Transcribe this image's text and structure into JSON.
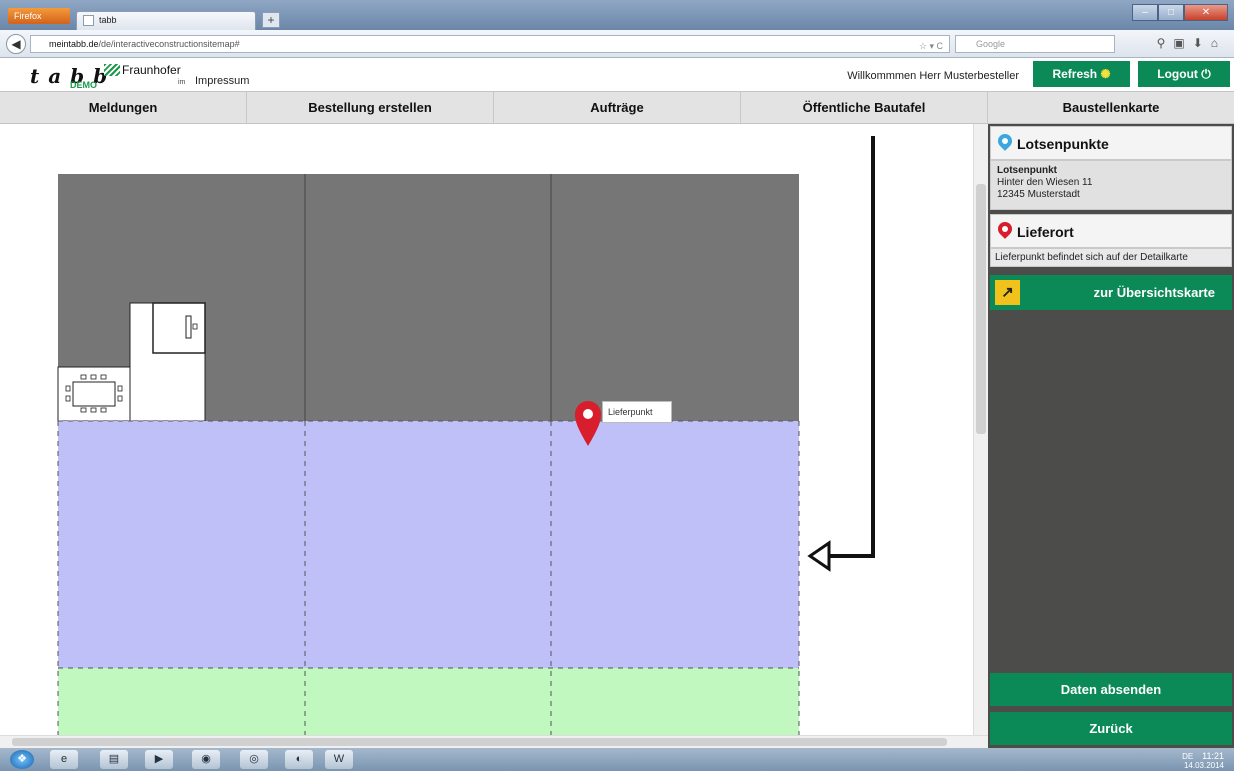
{
  "browser": {
    "app_button": "Firefox",
    "tab_title": "tabb",
    "new_tab": "+",
    "url_host": "meintabb.de",
    "url_path": "/de/interactiveconstructionsitemap#",
    "search_placeholder": "Google"
  },
  "header": {
    "logo": "t a b b",
    "demo": "DEMO",
    "fraunhofer": "Fraunhofer",
    "impressum_prefix": "im",
    "impressum": "Impressum",
    "welcome": "Willkommmen Herr Musterbesteller",
    "refresh": "Refresh",
    "logout": "Logout"
  },
  "tabs": [
    "Meldungen",
    "Bestellung erstellen",
    "Aufträge",
    "Öffentliche Bautafel",
    "Baustellenkarte"
  ],
  "map": {
    "pin_label": "Lieferpunkt",
    "colors": {
      "building": "#767676",
      "zone_blue": "#c0c0f8",
      "zone_green": "#c0f8c0",
      "pin": "#d81e2c"
    }
  },
  "panel": {
    "lotsen_title": "Lotsenpunkte",
    "lotsen_name": "Lotsenpunkt",
    "lotsen_street": "Hinter den Wiesen 11",
    "lotsen_city": "12345 Musterstadt",
    "liefer_title": "Lieferort",
    "liefer_text": "Lieferpunkt befindet sich auf der Detailkarte",
    "uebersicht": "zur Übersichtskarte",
    "senden": "Daten absenden",
    "zurueck": "Zurück",
    "colors": {
      "accent": "#0b8a57",
      "lotsen_pin": "#3aa7e0",
      "liefer_pin": "#d81e2c"
    }
  },
  "taskbar": {
    "lang": "DE",
    "time": "11:21",
    "date": "14.03.2014"
  }
}
